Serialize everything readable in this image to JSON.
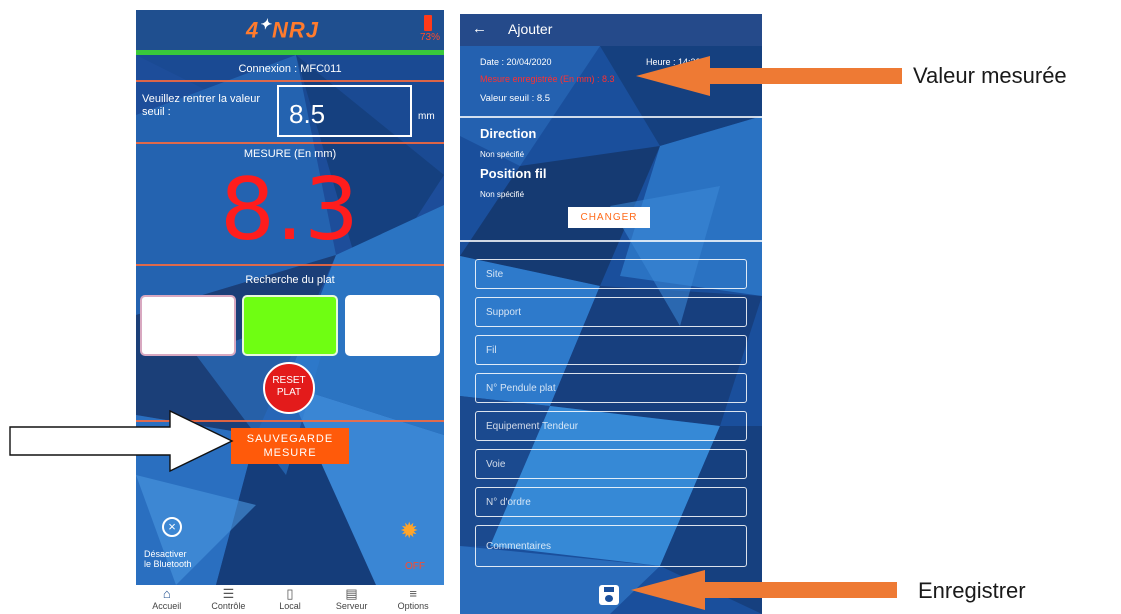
{
  "phone1": {
    "logo": "NRJ",
    "battery_pct": "73%",
    "connexion": "Connexion : MFC011",
    "seuil_label": "Veuillez rentrer la valeur seuil :",
    "seuil_value": "8.5",
    "seuil_unit": "mm",
    "mesure_label": "MESURE (En mm)",
    "mesure_value": "8.3",
    "recherche_label": "Recherche du plat",
    "reset_label_1": "RESET",
    "reset_label_2": "PLAT",
    "save_label_1": "SAUVEGARDE",
    "save_label_2": "MESURE",
    "bluetooth_label_1": "Désactiver",
    "bluetooth_label_2": "le Bluetooth",
    "light_label": "OFF",
    "tabs": [
      {
        "label": "Accueil",
        "icon": "home-icon"
      },
      {
        "label": "Contrôle",
        "icon": "checklist-icon"
      },
      {
        "label": "Local",
        "icon": "phone-icon"
      },
      {
        "label": "Serveur",
        "icon": "server-icon"
      },
      {
        "label": "Options",
        "icon": "menu-icon"
      }
    ],
    "plat_colors": [
      "#ffffff",
      "#6ffe12",
      "#ffffff"
    ]
  },
  "phone2": {
    "title": "Ajouter",
    "date": "Date : 20/04/2020",
    "heure": "Heure : 14:30",
    "mesure_enregistree": "Mesure enregistrée (En mm) : 8.3",
    "valeur_seuil": "Valeur seuil : 8.5",
    "direction_heading": "Direction",
    "direction_value": "Non spécifié",
    "position_heading": "Position fil",
    "position_value": "Non spécifié",
    "changer_label": "CHANGER",
    "fields": [
      "Site",
      "Support",
      "Fil",
      "N° Pendule plat",
      "Equipement Tendeur",
      "Voie",
      "N° d'ordre",
      "Commentaires"
    ]
  },
  "annotations": {
    "valeur_mesuree": "Valeur mesurée",
    "enregistrer": "Enregistrer"
  },
  "colors": {
    "accent_orange": "#ff5a0a",
    "arrow_orange": "#ee7a34",
    "measure_red": "#ff1d1d",
    "background_blue": "#1d4d9a"
  }
}
